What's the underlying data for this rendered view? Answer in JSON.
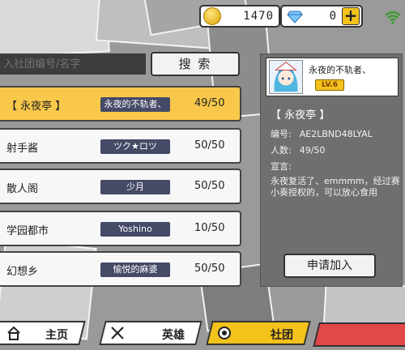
{
  "topbar": {
    "coins": "1470",
    "gems": "0",
    "plus_label": "+",
    "coin_icon": "gold-coin-icon",
    "gem_icon": "diamond-icon",
    "wifi_icon": "wifi-icon"
  },
  "search": {
    "placeholder": "入社团编号/名字",
    "button_label": "搜 索"
  },
  "guilds": [
    {
      "name": "【 永夜亭 】",
      "leader": "永夜的不轨者、",
      "members": "49/50",
      "selected": true
    },
    {
      "name": "射手酱",
      "leader": "ツク★ロツ",
      "members": "50/50",
      "selected": false
    },
    {
      "name": "散人阁",
      "leader": "少月",
      "members": "50/50",
      "selected": false
    },
    {
      "name": "学园都市",
      "leader": "Yoshino",
      "members": "10/50",
      "selected": false
    },
    {
      "name": "幻想乡",
      "leader": "愉悦的麻婆",
      "members": "50/50",
      "selected": false
    }
  ],
  "detail": {
    "leader_name": "永夜的不轨者、",
    "level_badge": "LV.6",
    "title": "【 永夜亭 】",
    "id_label": "编号:",
    "id_value": "AE2LBND48LYAL",
    "members_label": "人数:",
    "members_value": "49/50",
    "declaration_label": "宣言:",
    "declaration": "永夜复活了、emmmm，经过赛小奏授权的，可以放心食用",
    "apply_button": "申请加入"
  },
  "nav": {
    "home": "主页",
    "hero": "英雄",
    "guild": "社团",
    "active": "guild"
  },
  "colors": {
    "accent": "#f9c84a",
    "leader_tag": "#454a66",
    "panel": "#6f6f6f"
  }
}
